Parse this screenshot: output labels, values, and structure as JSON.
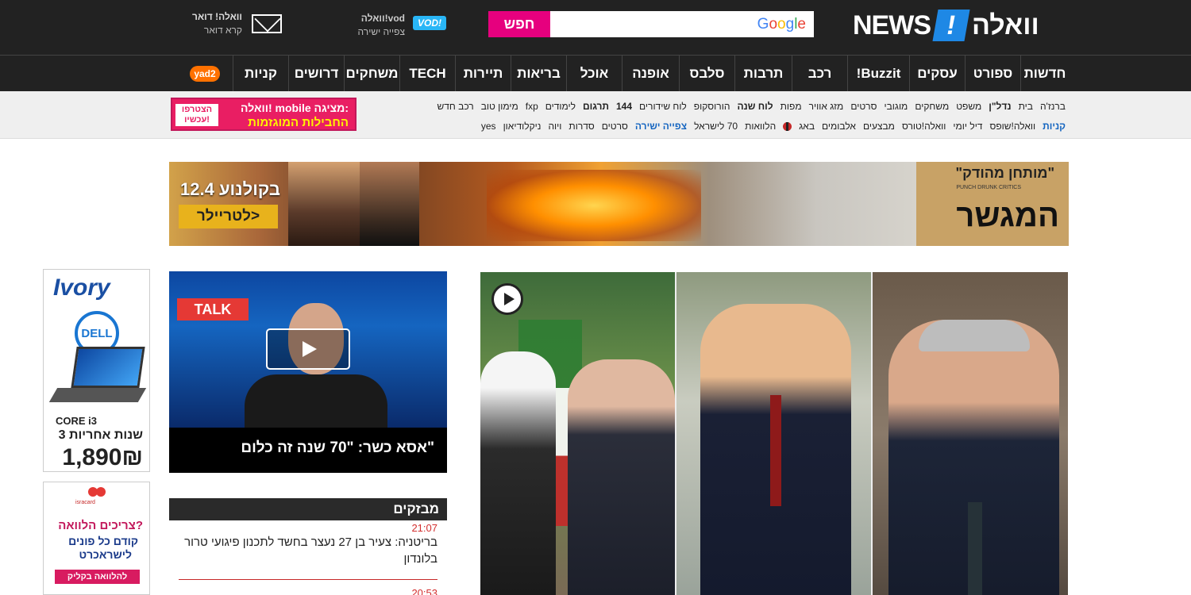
{
  "header": {
    "logo_walla": "וואלה",
    "logo_bang": "!",
    "logo_news": "NEWS",
    "search_button": "חפש",
    "search_placeholder": "",
    "search_brand": "Google",
    "vod_badge": "VOD!",
    "vod_title": "וואלה!vod",
    "vod_sub": "צפייה ישירה",
    "mail_title": "וואלה! דואר",
    "mail_sub": "קרא דואר"
  },
  "nav": {
    "items": [
      "חדשות",
      "ספורט",
      "עסקים",
      "Buzzit!",
      "רכב",
      "תרבות",
      "סלבס",
      "אופנה",
      "אוכל",
      "בריאות",
      "תיירות",
      "TECH",
      "משחקים",
      "דרושים",
      "קניות"
    ],
    "yad2": "yad2"
  },
  "subnav": {
    "row1": [
      "ברנז'ה",
      "בית",
      "נדל\"ן",
      "משפט",
      "משחקים",
      "מוגובי",
      "סרטים",
      "מזג אוויר",
      "מפות",
      "לוח שנה",
      "הורוסקופ",
      "לוח שידורים",
      "לימודים",
      "fxp",
      "מימון טוב",
      "רכב חדש"
    ],
    "row1_144": "144",
    "row1_targum": "תרגום",
    "row2": [
      "קניות",
      "וואלה!שופס",
      "דיל יומי",
      "וואלה!טורס",
      "מבצעים",
      "אלבומים",
      "באג",
      "הלוואות",
      "70 לישראל",
      "צפייה ישירה",
      "סרטים",
      "סדרות",
      "ויוה",
      "ניקלודיאון",
      "yes"
    ],
    "mobile_ad_l1": "וואלה! mobile מציגה:",
    "mobile_ad_l2": "החבילות המוגזמות",
    "mobile_ad_cta": "הצטרפו עכשיו!"
  },
  "banner": {
    "date_text": "12.4 בקולנוע",
    "trailer": "לטריילר>",
    "critics": "\"מותחן מהודק\"",
    "critics_en": "PUNCH DRUNK CRITICS",
    "movie": "המגשר"
  },
  "ads": {
    "ivory_logo": "Ivory",
    "dell": "DELL",
    "core": "CORE i3",
    "warranty": "3 שנות אחריות",
    "price": "1,890₪",
    "isra_tag": "isracard",
    "isra_h": "צריכים הלוואה?",
    "isra_s1": "קודם כל פונים",
    "isra_s2": "לישראכרט",
    "isra_cta": "להלוואה בקליק"
  },
  "video": {
    "talk_label": "TALK",
    "caption": "אסא כשר: \"70 שנה זה כלום\""
  },
  "breaking": {
    "title": "מבזקים",
    "items": [
      {
        "time": "21:07",
        "text": "בריטניה: צעיר בן 27 נעצר בחשד לתכנון פיגועי טרור בלונדון"
      },
      {
        "time": "20:53",
        "text": ""
      }
    ]
  }
}
